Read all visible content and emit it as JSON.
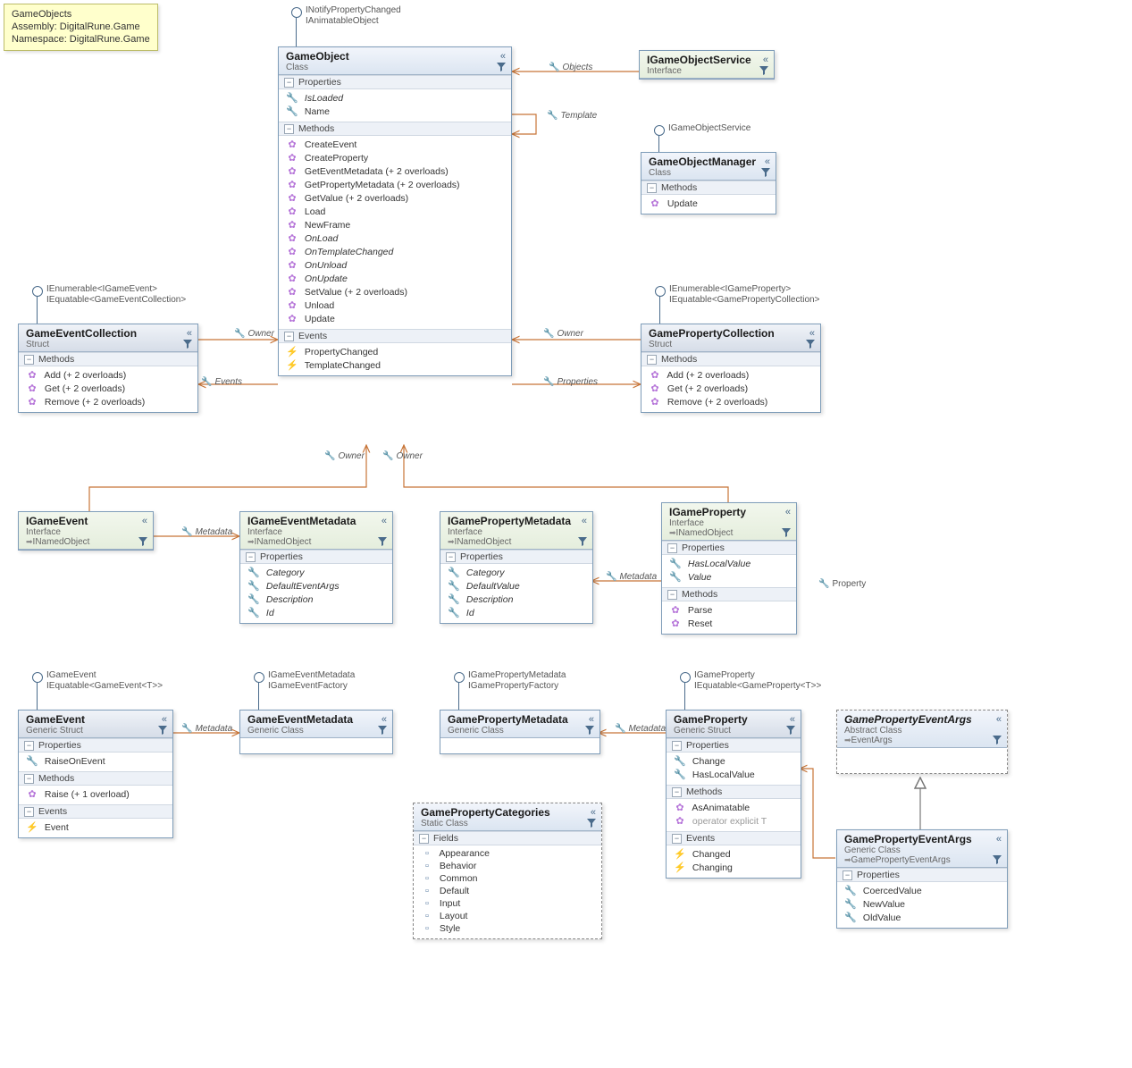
{
  "legend": {
    "title": "GameObjects",
    "line2": "Assembly: DigitalRune.Game",
    "line3": "Namespace: DigitalRune.Game"
  },
  "entities": {
    "gameobject": {
      "title": "GameObject",
      "subtitle": "Class",
      "lollipop": [
        "INotifyPropertyChanged",
        "IAnimatableObject"
      ],
      "sections": [
        {
          "name": "Properties",
          "members": [
            {
              "icon": "prop",
              "name": "IsLoaded",
              "italic": true
            },
            {
              "icon": "prop",
              "name": "Name"
            }
          ]
        },
        {
          "name": "Methods",
          "members": [
            {
              "icon": "method",
              "name": "CreateEvent<T>"
            },
            {
              "icon": "method",
              "name": "CreateProperty<T>"
            },
            {
              "icon": "method",
              "name": "GetEventMetadata<T> (+ 2 overloads)"
            },
            {
              "icon": "method",
              "name": "GetPropertyMetadata<T> (+ 2 overloads)"
            },
            {
              "icon": "method",
              "name": "GetValue<T> (+ 2 overloads)"
            },
            {
              "icon": "method",
              "name": "Load"
            },
            {
              "icon": "method",
              "name": "NewFrame"
            },
            {
              "icon": "method",
              "name": "OnLoad",
              "italic": true
            },
            {
              "icon": "method",
              "name": "OnTemplateChanged",
              "italic": true
            },
            {
              "icon": "method",
              "name": "OnUnload",
              "italic": true
            },
            {
              "icon": "method",
              "name": "OnUpdate",
              "italic": true
            },
            {
              "icon": "method",
              "name": "SetValue<T> (+ 2 overloads)"
            },
            {
              "icon": "method",
              "name": "Unload"
            },
            {
              "icon": "method",
              "name": "Update"
            }
          ]
        },
        {
          "name": "Events",
          "members": [
            {
              "icon": "event",
              "name": "PropertyChanged"
            },
            {
              "icon": "event",
              "name": "TemplateChanged"
            }
          ]
        }
      ]
    },
    "igameobjectservice": {
      "title": "IGameObjectService",
      "subtitle": "Interface",
      "lollipop": [],
      "sections": []
    },
    "gameobjectmanager": {
      "title": "GameObjectManager",
      "subtitle": "Class",
      "lollipop": [
        "IGameObjectService"
      ],
      "sections": [
        {
          "name": "Methods",
          "members": [
            {
              "icon": "method",
              "name": "Update"
            }
          ]
        }
      ]
    },
    "gameeventcollection": {
      "title": "GameEventCollection",
      "subtitle": "Struct",
      "lollipop": [
        "IEnumerable<IGameEvent>",
        "IEquatable<GameEventCollection>"
      ],
      "sections": [
        {
          "name": "Methods",
          "members": [
            {
              "icon": "method",
              "name": "Add<T> (+ 2 overloads)"
            },
            {
              "icon": "method",
              "name": "Get<T> (+ 2 overloads)"
            },
            {
              "icon": "method",
              "name": "Remove<T> (+ 2 overloads)"
            }
          ]
        }
      ]
    },
    "gamepropertycollection": {
      "title": "GamePropertyCollection",
      "subtitle": "Struct",
      "lollipop": [
        "IEnumerable<IGameProperty>",
        "IEquatable<GamePropertyCollection>"
      ],
      "sections": [
        {
          "name": "Methods",
          "members": [
            {
              "icon": "method",
              "name": "Add<T> (+ 2 overloads)"
            },
            {
              "icon": "method",
              "name": "Get<T> (+ 2 overloads)"
            },
            {
              "icon": "method",
              "name": "Remove<T> (+ 2 overloads)"
            }
          ]
        }
      ]
    },
    "igameevent": {
      "title": "IGameEvent",
      "subtitle": "Interface",
      "impl": "INamedObject",
      "lollipop": [],
      "sections": []
    },
    "igameeventmetadata": {
      "title": "IGameEventMetadata",
      "subtitle": "Interface",
      "impl": "INamedObject",
      "lollipop": [],
      "sections": [
        {
          "name": "Properties",
          "members": [
            {
              "icon": "prop",
              "name": "Category",
              "italic": true
            },
            {
              "icon": "prop",
              "name": "DefaultEventArgs",
              "italic": true
            },
            {
              "icon": "prop",
              "name": "Description",
              "italic": true
            },
            {
              "icon": "prop",
              "name": "Id",
              "italic": true
            }
          ]
        }
      ]
    },
    "igamepropertymetadata": {
      "title": "IGamePropertyMetadata",
      "subtitle": "Interface",
      "impl": "INamedObject",
      "lollipop": [],
      "sections": [
        {
          "name": "Properties",
          "members": [
            {
              "icon": "prop",
              "name": "Category",
              "italic": true
            },
            {
              "icon": "prop",
              "name": "DefaultValue",
              "italic": true
            },
            {
              "icon": "prop",
              "name": "Description",
              "italic": true
            },
            {
              "icon": "prop",
              "name": "Id",
              "italic": true
            }
          ]
        }
      ]
    },
    "igameproperty": {
      "title": "IGameProperty",
      "subtitle": "Interface",
      "impl": "INamedObject",
      "lollipop": [],
      "sections": [
        {
          "name": "Properties",
          "members": [
            {
              "icon": "prop",
              "name": "HasLocalValue",
              "italic": true
            },
            {
              "icon": "prop",
              "name": "Value",
              "italic": true
            }
          ]
        },
        {
          "name": "Methods",
          "members": [
            {
              "icon": "method",
              "name": "Parse"
            },
            {
              "icon": "method",
              "name": "Reset"
            }
          ]
        }
      ]
    },
    "gameeventt": {
      "title": "GameEvent<T>",
      "subtitle": "Generic Struct",
      "lollipop": [
        "IGameEvent",
        "IEquatable<GameEvent<T>>"
      ],
      "sections": [
        {
          "name": "Properties",
          "members": [
            {
              "icon": "prop",
              "name": "RaiseOnEvent"
            }
          ]
        },
        {
          "name": "Methods",
          "members": [
            {
              "icon": "method",
              "name": "Raise (+ 1 overload)"
            }
          ]
        },
        {
          "name": "Events",
          "members": [
            {
              "icon": "event",
              "name": "Event"
            }
          ]
        }
      ]
    },
    "gameeventmetadatat": {
      "title": "GameEventMetadata<T>",
      "subtitle": "Generic Class",
      "lollipop": [
        "IGameEventMetadata",
        "IGameEventFactory"
      ],
      "sections": []
    },
    "gamepropertymetadatat": {
      "title": "GamePropertyMetadata<T>",
      "subtitle": "Generic Class",
      "lollipop": [
        "IGamePropertyMetadata",
        "IGamePropertyFactory"
      ],
      "sections": []
    },
    "gamepropertyt": {
      "title": "GameProperty<T>",
      "subtitle": "Generic Struct",
      "lollipop": [
        "IGameProperty",
        "IEquatable<GameProperty<T>>"
      ],
      "sections": [
        {
          "name": "Properties",
          "members": [
            {
              "icon": "prop",
              "name": "Change"
            },
            {
              "icon": "prop",
              "name": "HasLocalValue"
            }
          ]
        },
        {
          "name": "Methods",
          "members": [
            {
              "icon": "method",
              "name": "AsAnimatable"
            },
            {
              "icon": "method",
              "name": "operator explicit T",
              "grey": true
            }
          ]
        },
        {
          "name": "Events",
          "members": [
            {
              "icon": "event",
              "name": "Changed"
            },
            {
              "icon": "event",
              "name": "Changing"
            }
          ]
        }
      ]
    },
    "gamepropertyeventargs": {
      "title": "GamePropertyEventArgs",
      "subtitle": "Abstract Class",
      "impl": "EventArgs",
      "lollipop": [],
      "sections": []
    },
    "gamepropertyeventargst": {
      "title": "GamePropertyEventArgs<T>",
      "subtitle": "Generic Class",
      "impl": "GamePropertyEventArgs",
      "lollipop": [],
      "sections": [
        {
          "name": "Properties",
          "members": [
            {
              "icon": "prop",
              "name": "CoercedValue"
            },
            {
              "icon": "prop",
              "name": "NewValue"
            },
            {
              "icon": "prop",
              "name": "OldValue"
            }
          ]
        }
      ]
    },
    "gamepropertycategories": {
      "title": "GamePropertyCategories",
      "subtitle": "Static Class",
      "lollipop": [],
      "sections": [
        {
          "name": "Fields",
          "members": [
            {
              "icon": "field",
              "name": "Appearance"
            },
            {
              "icon": "field",
              "name": "Behavior"
            },
            {
              "icon": "field",
              "name": "Common"
            },
            {
              "icon": "field",
              "name": "Default"
            },
            {
              "icon": "field",
              "name": "Input"
            },
            {
              "icon": "field",
              "name": "Layout"
            },
            {
              "icon": "field",
              "name": "Style"
            }
          ]
        }
      ]
    }
  },
  "connector_labels": {
    "objects": "Objects",
    "template": "Template",
    "owner": "Owner",
    "events": "Events",
    "properties": "Properties",
    "metadata": "Metadata",
    "property": "Property"
  }
}
